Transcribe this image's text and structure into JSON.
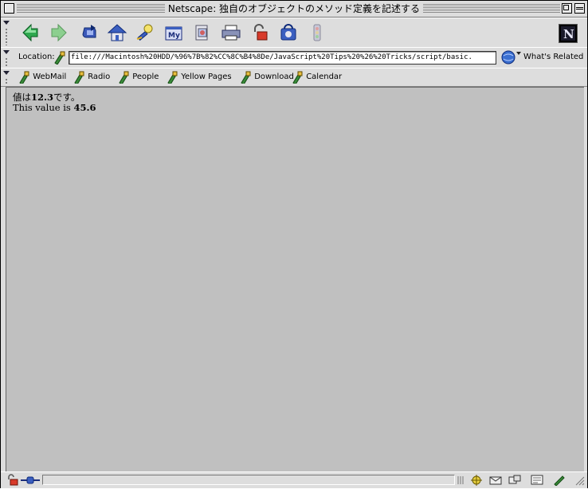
{
  "window": {
    "title": "Netscape: 独自のオブジェクトのメソッド定義を記述する"
  },
  "location": {
    "label": "Location:",
    "url": "file:///Macintosh%20HDD/%96%7B%82%CC%8C%B4%8De/JavaScript%20Tips%20%26%20Tricks/script/basic.",
    "whats_related": "What's Related"
  },
  "bookmarks": [
    {
      "label": "WebMail"
    },
    {
      "label": "Radio"
    },
    {
      "label": "People"
    },
    {
      "label": "Yellow Pages"
    },
    {
      "label": "Download"
    },
    {
      "label": "Calendar"
    }
  ],
  "content": {
    "line1_prefix": "値は",
    "line1_value": "12.3",
    "line1_suffix": "です。",
    "line2_prefix": "This value is ",
    "line2_value": "45.6"
  },
  "icons": {
    "back": "back-arrow-icon",
    "forward": "forward-arrow-icon",
    "reload": "reload-icon",
    "home": "home-icon",
    "search": "search-icon",
    "my_netscape": "my-netscape-icon",
    "images": "images-icon",
    "print": "print-icon",
    "security": "security-lock-icon",
    "shop": "shop-icon",
    "stop": "stop-icon",
    "netscape_logo": "netscape-logo-icon"
  },
  "colors": {
    "chrome": "#dddddd",
    "content_bg": "#c0c0c0"
  }
}
